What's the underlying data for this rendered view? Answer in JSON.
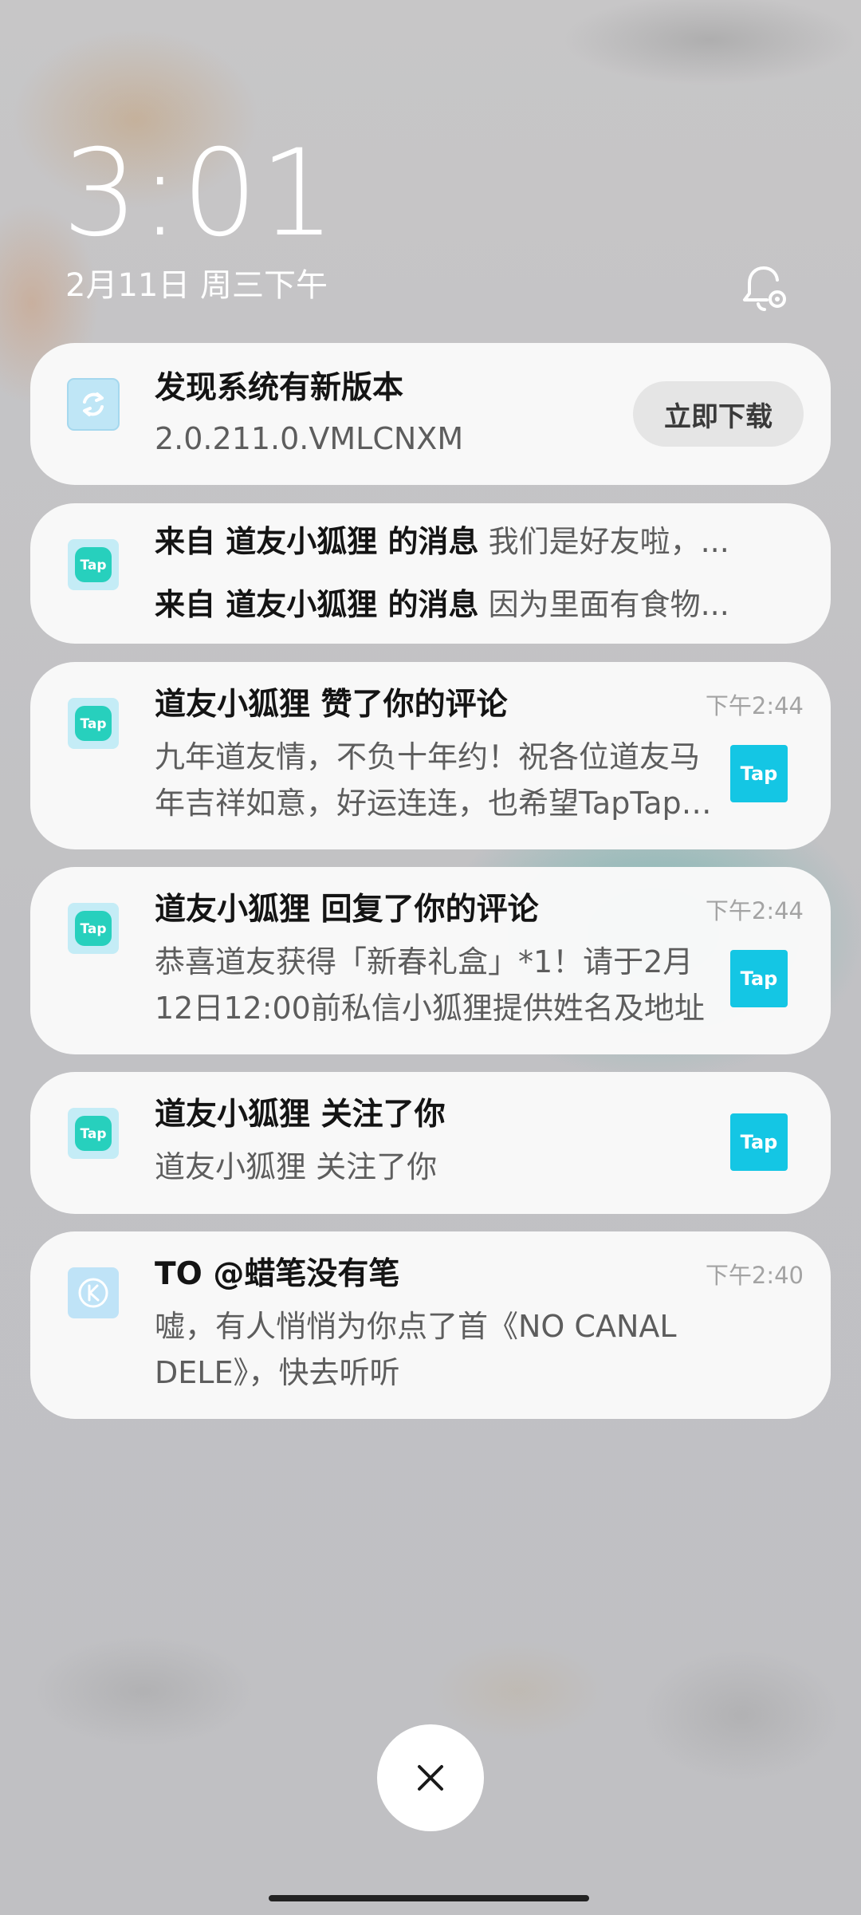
{
  "lockscreen": {
    "time": "3:01",
    "date": "2月11日 周三下午"
  },
  "notifications": [
    {
      "app_icon": "system-update-icon",
      "title": "发现系统有新版本",
      "body": "2.0.211.0.VMLCNXM",
      "action_label": "立即下载"
    },
    {
      "app_icon": "taptap-icon",
      "line1_bold": "来自 道友小狐狸 的消息",
      "line1_text": "我们是好友啦，...",
      "line2_bold": "来自 道友小狐狸 的消息",
      "line2_text": "因为里面有食物..."
    },
    {
      "app_icon": "taptap-icon",
      "title": "道友小狐狸 赞了你的评论",
      "body": "九年道友情，不负十年约！祝各位道友马年吉祥如意，好运连连，也希望TapTap越来越好！",
      "time": "下午2:44",
      "thumb_label": "Tap"
    },
    {
      "app_icon": "taptap-icon",
      "title": "道友小狐狸 回复了你的评论",
      "body": "恭喜道友获得「新春礼盒」*1！请于2月12日12:00前私信小狐狸提供姓名及地址",
      "time": "下午2:44",
      "thumb_label": "Tap"
    },
    {
      "app_icon": "taptap-icon",
      "title": "道友小狐狸 关注了你",
      "body": "道友小狐狸 关注了你",
      "thumb_label": "Tap"
    },
    {
      "app_icon": "kugou-icon",
      "title": "TO @蜡笔没有笔",
      "body": "嘘，有人悄悄为你点了首《NO CANAL DELE》，快去听听",
      "time": "下午2:40"
    }
  ],
  "taptap_label": "Tap",
  "colors": {
    "tap_teal": "#27d0bd",
    "tap_cyan": "#14c6e4"
  }
}
